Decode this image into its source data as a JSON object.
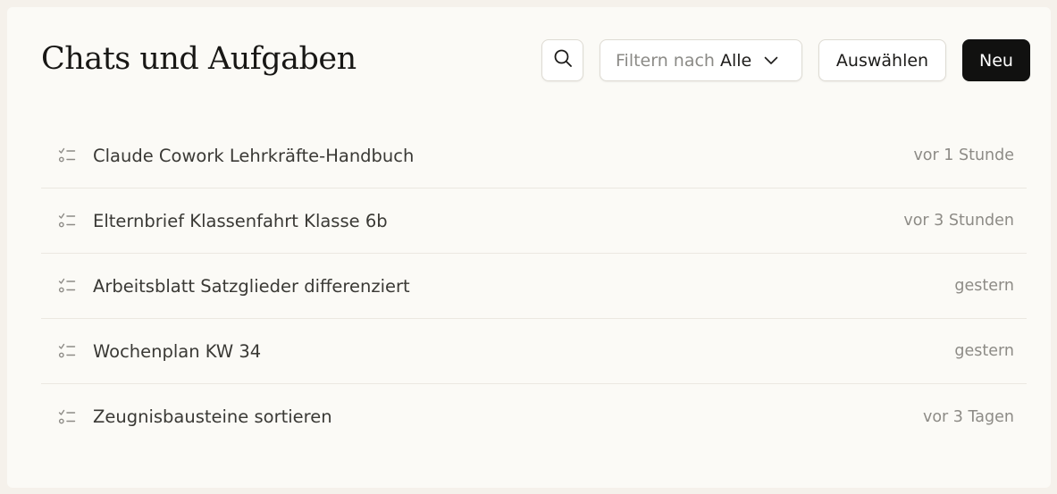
{
  "header": {
    "title": "Chats und Aufgaben"
  },
  "toolbar": {
    "search_icon": "search-icon",
    "filter_prefix": "Filtern nach",
    "filter_value": "Alle",
    "filter_chevron_icon": "chevron-down-icon",
    "select_label": "Auswählen",
    "new_label": "Neu"
  },
  "colors": {
    "background": "#f5f1eb",
    "panel": "#fbfaf6",
    "primary_button": "#111110",
    "text": "#3a3935",
    "muted_text": "#8d8b86"
  },
  "items": [
    {
      "icon": "task-list-icon",
      "title": "Claude Cowork Lehrkräfte-Handbuch",
      "time": "vor 1 Stunde"
    },
    {
      "icon": "task-list-icon",
      "title": "Elternbrief Klassenfahrt Klasse 6b",
      "time": "vor 3 Stunden"
    },
    {
      "icon": "task-list-icon",
      "title": "Arbeitsblatt Satzglieder differenziert",
      "time": "gestern"
    },
    {
      "icon": "task-list-icon",
      "title": "Wochenplan KW 34",
      "time": "gestern"
    },
    {
      "icon": "task-list-icon",
      "title": "Zeugnisbausteine sortieren",
      "time": "vor 3 Tagen"
    }
  ]
}
